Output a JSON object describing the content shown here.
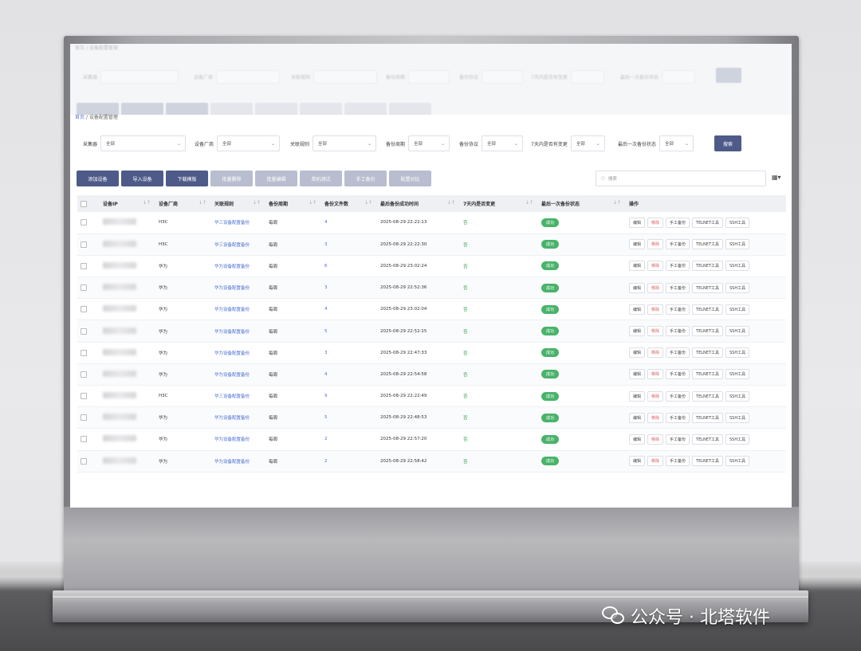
{
  "breadcrumb": {
    "home": "首页",
    "sep": "/",
    "current": "设备配置管理"
  },
  "filters": [
    {
      "label": "采集器",
      "value": "全部"
    },
    {
      "label": "设备厂商",
      "value": "全部"
    },
    {
      "label": "关联规则",
      "value": "全部"
    },
    {
      "label": "备份周期",
      "value": "全部"
    },
    {
      "label": "备份协议",
      "value": "全部"
    },
    {
      "label": "7天内是否有变更",
      "value": "全部"
    },
    {
      "label": "最后一次备份状态",
      "value": "全部"
    }
  ],
  "query_label": "搜索",
  "toolbar": [
    {
      "label": "添加设备",
      "enabled": true
    },
    {
      "label": "导入设备",
      "enabled": true
    },
    {
      "label": "下载模版",
      "enabled": true
    },
    {
      "label": "批量删除",
      "enabled": false
    },
    {
      "label": "批量编辑",
      "enabled": false
    },
    {
      "label": "单机测试",
      "enabled": false
    },
    {
      "label": "手工备份",
      "enabled": false
    },
    {
      "label": "配置对比",
      "enabled": false
    }
  ],
  "search_placeholder": "搜索",
  "table": {
    "columns": [
      "设备IP",
      "设备厂商",
      "关联规则",
      "备份周期",
      "备份文件数",
      "最后备份成功时间",
      "7天内是否变更",
      "最后一次备份状态",
      "操作"
    ],
    "actions": [
      "编辑",
      "移除",
      "手工备份",
      "TELNET工具",
      "SSH工具"
    ],
    "rows": [
      {
        "vendor": "H3C",
        "rule": "华三设备配置备份",
        "cycle": "每周",
        "files": "4",
        "time": "2025-08-29 22:22:13",
        "changed": "否",
        "status": "成功"
      },
      {
        "vendor": "H3C",
        "rule": "华三设备配置备份",
        "cycle": "每周",
        "files": "3",
        "time": "2025-08-29 22:22:30",
        "changed": "否",
        "status": "成功"
      },
      {
        "vendor": "华为",
        "rule": "华为设备配置备份",
        "cycle": "每周",
        "files": "6",
        "time": "2025-08-29 23:02:24",
        "changed": "否",
        "status": "成功"
      },
      {
        "vendor": "华为",
        "rule": "华为设备配置备份",
        "cycle": "每周",
        "files": "3",
        "time": "2025-08-29 22:52:36",
        "changed": "否",
        "status": "成功"
      },
      {
        "vendor": "华为",
        "rule": "华为设备配置备份",
        "cycle": "每周",
        "files": "4",
        "time": "2025-08-29 23:02:04",
        "changed": "否",
        "status": "成功"
      },
      {
        "vendor": "华为",
        "rule": "华为设备配置备份",
        "cycle": "每周",
        "files": "5",
        "time": "2025-08-29 22:52:15",
        "changed": "否",
        "status": "成功"
      },
      {
        "vendor": "华为",
        "rule": "华为设备配置备份",
        "cycle": "每周",
        "files": "3",
        "time": "2025-08-29 22:47:33",
        "changed": "否",
        "status": "成功"
      },
      {
        "vendor": "华为",
        "rule": "华为设备配置备份",
        "cycle": "每周",
        "files": "4",
        "time": "2025-08-29 22:54:58",
        "changed": "否",
        "status": "成功"
      },
      {
        "vendor": "H3C",
        "rule": "华三设备配置备份",
        "cycle": "每周",
        "files": "9",
        "time": "2025-08-29 22:22:49",
        "changed": "否",
        "status": "成功"
      },
      {
        "vendor": "华为",
        "rule": "华为设备配置备份",
        "cycle": "每周",
        "files": "5",
        "time": "2025-08-29 22:48:53",
        "changed": "否",
        "status": "成功"
      },
      {
        "vendor": "华为",
        "rule": "华为设备配置备份",
        "cycle": "每周",
        "files": "2",
        "time": "2025-08-29 22:57:20",
        "changed": "否",
        "status": "成功"
      },
      {
        "vendor": "华为",
        "rule": "华为设备配置备份",
        "cycle": "每周",
        "files": "2",
        "time": "2025-08-29 22:58:42",
        "changed": "否",
        "status": "成功"
      }
    ]
  },
  "watermark": "公众号 · 北塔软件",
  "colors": {
    "primary": "#4e5b89",
    "link": "#4a6fd4",
    "success": "#49b36a",
    "danger": "#e05c5c"
  }
}
